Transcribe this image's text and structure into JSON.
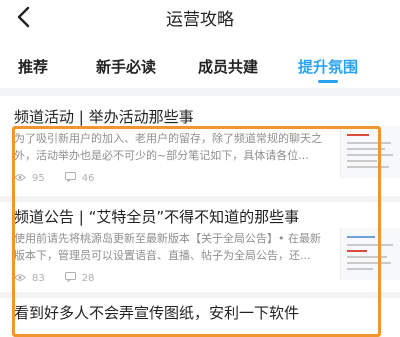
{
  "header": {
    "title": "运营攻略",
    "back_icon": "chevron-left-icon"
  },
  "tabs": [
    {
      "label": "推荐",
      "active": false
    },
    {
      "label": "新手必读",
      "active": false
    },
    {
      "label": "成员共建",
      "active": false
    },
    {
      "label": "提升氛围",
      "active": true
    }
  ],
  "articles": [
    {
      "title": "频道活动 | 举办活动那些事",
      "excerpt": "为了吸引新用户的加入、老用户的留存，除了频道常规的聊天之外，活动举办也是必不可少的~部分笔记如下，具体请各位...",
      "views": "95",
      "comments": "46"
    },
    {
      "title": "频道公告 | “艾特全员”不得不知道的那些事",
      "excerpt": "使用前请先将桃源岛更新至最新版本【关于全局公告】• 在最新版本下，管理员可以设置语音、直播、帖子为全局公告，还...",
      "views": "83",
      "comments": "28"
    },
    {
      "title": "看到好多人不会弄宣传图纸，安利一下软件"
    }
  ],
  "colors": {
    "accent": "#2aa3f0",
    "highlight": "#f0962c"
  }
}
